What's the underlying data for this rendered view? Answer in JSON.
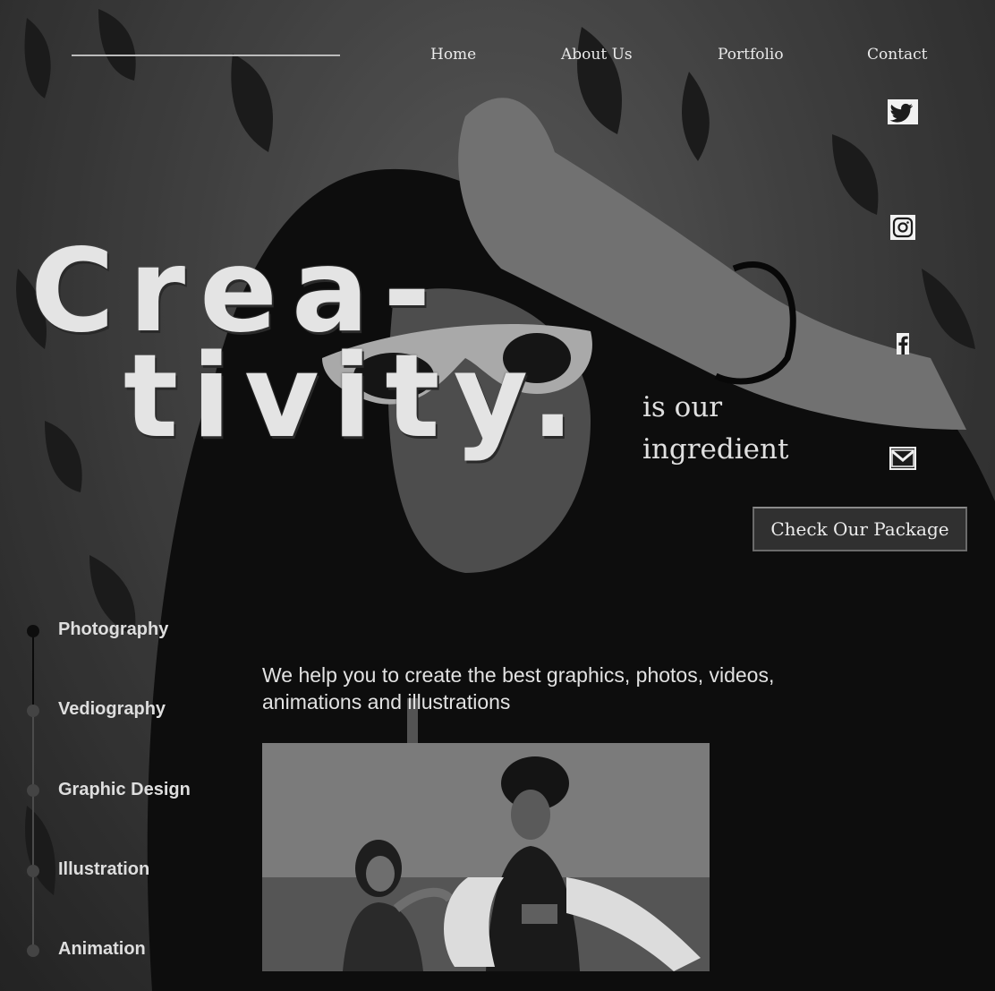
{
  "nav": {
    "items": [
      {
        "label": "Home"
      },
      {
        "label": "About Us"
      },
      {
        "label": "Portfolio"
      },
      {
        "label": "Contact"
      }
    ]
  },
  "social": {
    "icons": [
      "twitter-icon",
      "instagram-icon",
      "facebook-icon",
      "mail-icon"
    ]
  },
  "hero": {
    "title_line1": "Crea-",
    "title_line2": "tivity.",
    "tagline_line1": "is our",
    "tagline_line2": "ingredient",
    "cta_label": "Check Our Package"
  },
  "services": {
    "items": [
      {
        "label": "Photography",
        "active": true
      },
      {
        "label": "Vediography",
        "active": false
      },
      {
        "label": "Graphic Design",
        "active": false
      },
      {
        "label": "Illustration",
        "active": false
      },
      {
        "label": "Animation",
        "active": false
      }
    ]
  },
  "main": {
    "description": "We help you to create the best graphics, photos, videos, animations and illustrations"
  },
  "colors": {
    "text": "#e6e6e6",
    "button_bg": "#303030",
    "timeline_active": "#0d0d0d",
    "timeline_inactive": "#444444"
  }
}
